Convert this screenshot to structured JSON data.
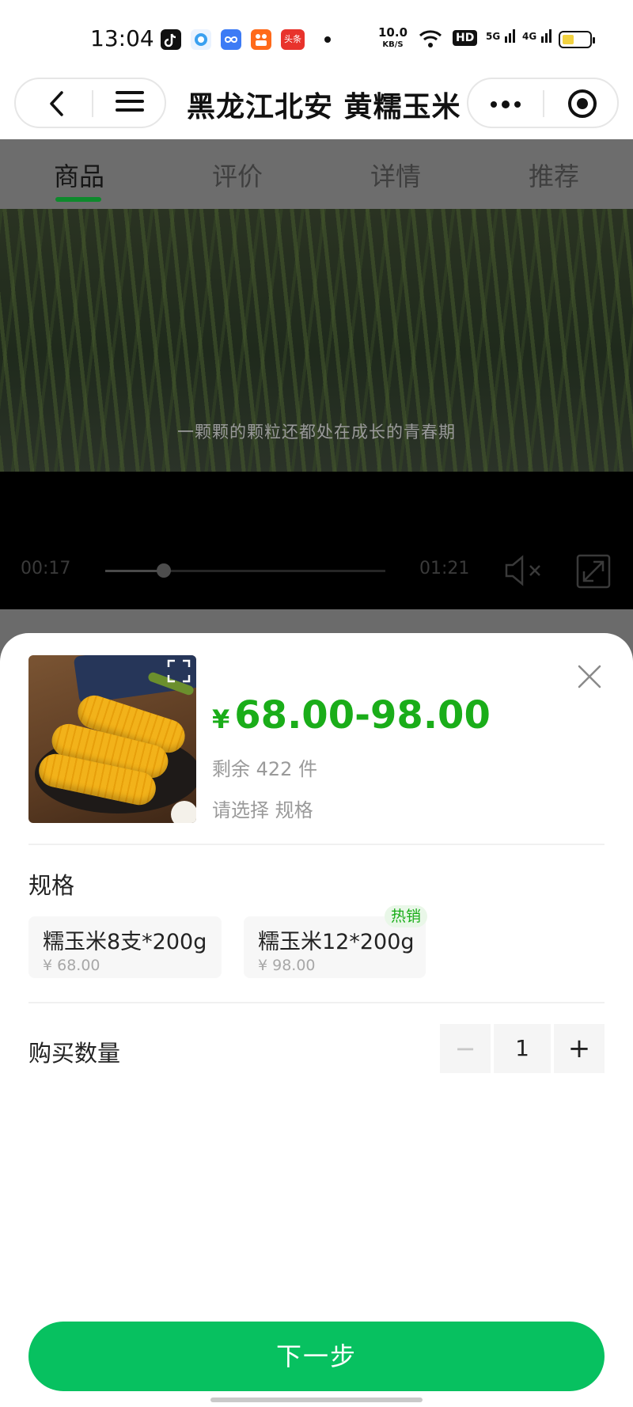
{
  "status_bar": {
    "time": "13:04",
    "net_speed_value": "10.0",
    "net_speed_unit": "KB/S",
    "hd_label": "HD",
    "signal_5g": "5G",
    "signal_4g": "4G",
    "apps": [
      "tiktok-icon",
      "browser-icon",
      "infinity-icon",
      "kuaishou-icon",
      "toutiao-icon"
    ],
    "toutiao_label": "头条"
  },
  "header": {
    "title": "黑龙江北安 黄糯玉米"
  },
  "tabs": [
    {
      "label": "商品",
      "active": true
    },
    {
      "label": "评价",
      "active": false
    },
    {
      "label": "详情",
      "active": false
    },
    {
      "label": "推荐",
      "active": false
    }
  ],
  "video": {
    "subtitle": "一颗颗的颗粒还都处在成长的青春期",
    "current_time": "00:17",
    "total_time": "01:21",
    "progress": 0.21,
    "muted": true
  },
  "sheet": {
    "currency": "¥",
    "price_range": "68.00-98.00",
    "stock_text": "剩余 422 件",
    "choose_text": "请选择 规格",
    "spec_label": "规格",
    "specs": [
      {
        "name": "糯玉米8支*200g",
        "price": "¥ 68.00"
      },
      {
        "name": "糯玉米12*200g",
        "price": "¥ 98.00"
      }
    ],
    "hot_badge": "热销",
    "quantity_label": "购买数量",
    "quantity_value": "1",
    "minus_label": "−",
    "plus_label": "+",
    "next_label": "下一步"
  },
  "colors": {
    "accent": "#1aad19",
    "button": "#07c160",
    "tab_active_underline": "#0e8a2c"
  }
}
